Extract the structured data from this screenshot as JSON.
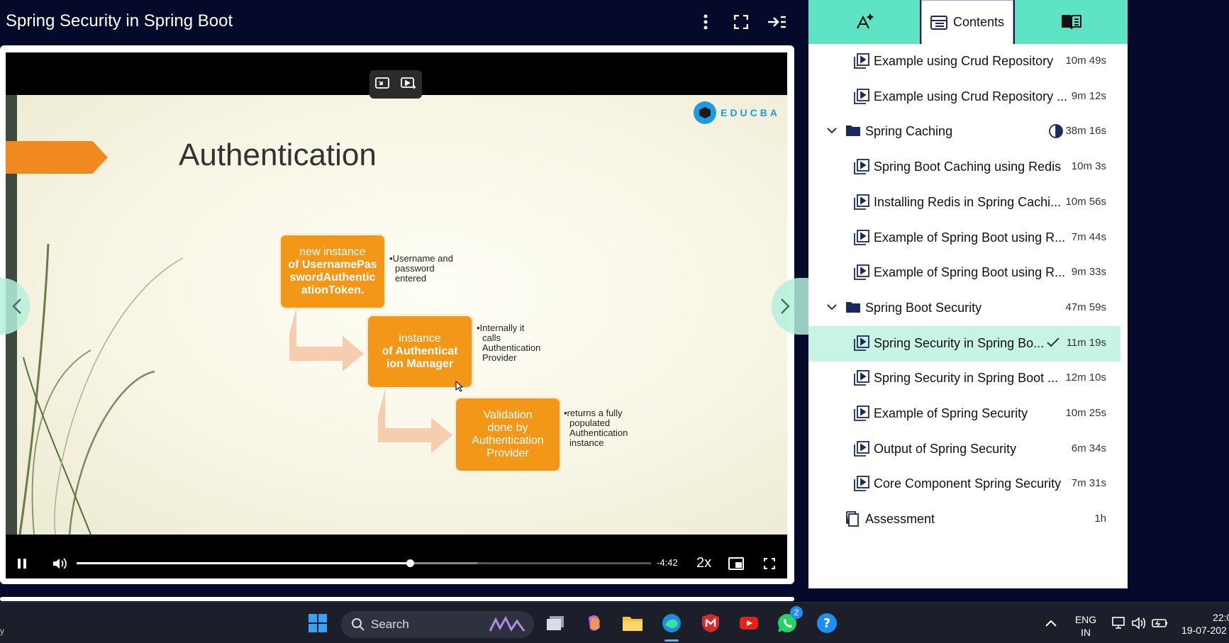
{
  "header": {
    "title": "Spring Security in Spring Boot"
  },
  "slide": {
    "title": "Authentication",
    "brand": "EDUCBA",
    "box1": {
      "line1": "new instance",
      "line2": "of UsernamePas",
      "line3": "swordAuthentic",
      "line4": "ationToken."
    },
    "note1": {
      "l1": "•Username and",
      "l2": "password",
      "l3": "entered"
    },
    "box2": {
      "line1": "instance",
      "line2": "of Authenticat",
      "line3": "ion Manager"
    },
    "note2": {
      "l1": "•Internally it",
      "l2": "calls",
      "l3": "Authentication",
      "l4": "Provider"
    },
    "box3": {
      "line1": "Validation",
      "line2": "done by",
      "line3": "Authentication",
      "line4": "Provider"
    },
    "note3": {
      "l1": "•returns a fully",
      "l2": "populated",
      "l3": "Authentication",
      "l4": "instance"
    }
  },
  "player": {
    "progress_fraction": 0.58,
    "time_remaining": "-4:42",
    "playback_rate": "2x"
  },
  "sidebar": {
    "tabs": {
      "contents_label": "Contents"
    },
    "items": [
      {
        "label": "Example using Crud Repository",
        "duration": "10m 49s"
      },
      {
        "label": "Example using Crud Repository ...",
        "duration": "9m 12s"
      },
      {
        "label": "Spring Caching",
        "duration": "38m 16s"
      },
      {
        "label": "Spring Boot Caching using Redis",
        "duration": "10m 3s"
      },
      {
        "label": "Installing Redis in Spring Cachi...",
        "duration": "10m 56s"
      },
      {
        "label": "Example of Spring Boot using R...",
        "duration": "7m 44s"
      },
      {
        "label": "Example of Spring Boot using R...",
        "duration": "9m 33s"
      },
      {
        "label": "Spring Boot Security",
        "duration": "47m 59s"
      },
      {
        "label": "Spring Security in Spring Bo...",
        "duration": "11m 19s"
      },
      {
        "label": "Spring Security in Spring Boot ...",
        "duration": "12m 10s"
      },
      {
        "label": "Example of Spring Security",
        "duration": "10m 25s"
      },
      {
        "label": "Output of Spring Security",
        "duration": "6m 34s"
      },
      {
        "label": "Core Component Spring Security",
        "duration": "7m 31s"
      },
      {
        "label": "Assessment",
        "duration": "1h"
      }
    ]
  },
  "taskbar": {
    "search_label": "Search",
    "whatsapp_badge": "2",
    "lang_line1": "ENG",
    "lang_line2": "IN",
    "clock_time": "22:0",
    "clock_date": "19-07-202",
    "left_edge_text": "y"
  },
  "colors": {
    "background": "#050a2a",
    "accent": "#5fe3c5",
    "slide_orange": "#f29718",
    "selected_row": "#c8f4e6"
  }
}
